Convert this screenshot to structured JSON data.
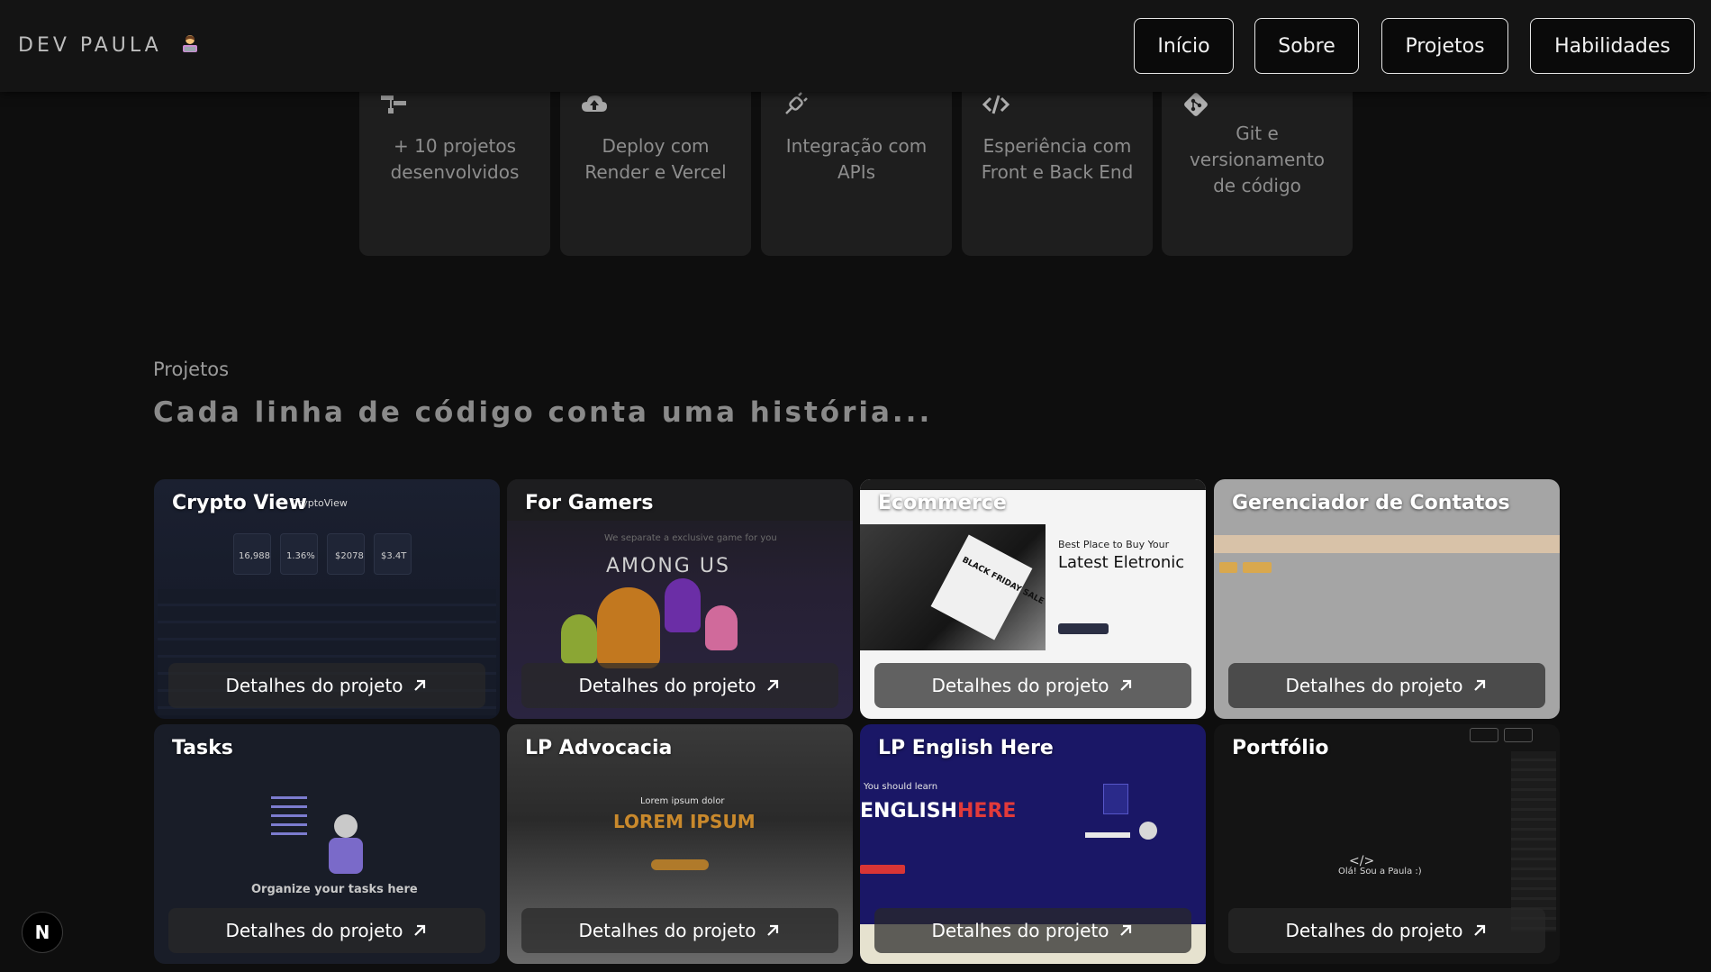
{
  "header": {
    "brand": "DEV PAULA",
    "brand_emoji_icon": "woman-technologist-icon",
    "nav": [
      "Início",
      "Sobre",
      "Projetos",
      "Habilidades"
    ]
  },
  "skills": [
    {
      "icon": "git-merge-icon",
      "text": "+ 10 projetos\ndesenvolvidos"
    },
    {
      "icon": "cloud-upload-icon",
      "text": "Deploy com\nRender e Vercel"
    },
    {
      "icon": "plug-icon",
      "text": "Integração com\nAPIs"
    },
    {
      "icon": "code-icon",
      "text": "Esperiência com\nFront e Back End"
    },
    {
      "icon": "git-icon",
      "text": "Git e\nversionamento\nde código"
    }
  ],
  "projects_section": {
    "kicker": "Projetos",
    "title": "Cada linha de código conta uma história..."
  },
  "projects": [
    {
      "title": "Crypto View",
      "button": "Detalhes do projeto"
    },
    {
      "title": "For Gamers",
      "button": "Detalhes do projeto"
    },
    {
      "title": "Ecommerce",
      "button": "Detalhes do projeto"
    },
    {
      "title": "Gerenciador de Contatos",
      "button": "Detalhes do projeto"
    },
    {
      "title": "Tasks",
      "button": "Detalhes do projeto"
    },
    {
      "title": "LP Advocacia",
      "button": "Detalhes do projeto"
    },
    {
      "title": "LP English Here",
      "button": "Detalhes do projeto"
    },
    {
      "title": "Portfólio",
      "button": "Detalhes do projeto"
    }
  ],
  "thumbs": {
    "crypto": {
      "logo": "CryptoView",
      "stats": [
        "16,988",
        "1.36%",
        "$2078",
        "$3.4T"
      ]
    },
    "gamers": {
      "tagline": "We separate a exclusive game for you",
      "game": "AMONG US"
    },
    "ecommerce": {
      "heading1": "Best Place to Buy Your",
      "heading2": "Latest Eletronic",
      "sign": "BLACK FRIDAY SALE"
    },
    "tasks": {
      "caption": "Organize your tasks here"
    },
    "advocacia": {
      "small": "Lorem ipsum dolor",
      "big": "LOREM IPSUM"
    },
    "english": {
      "small": "You should learn",
      "big1": "ENGLISH",
      "big2": "HERE"
    },
    "portfolio": {
      "greeting": "Olá! Sou a Paula :)"
    }
  },
  "next_badge": "N"
}
